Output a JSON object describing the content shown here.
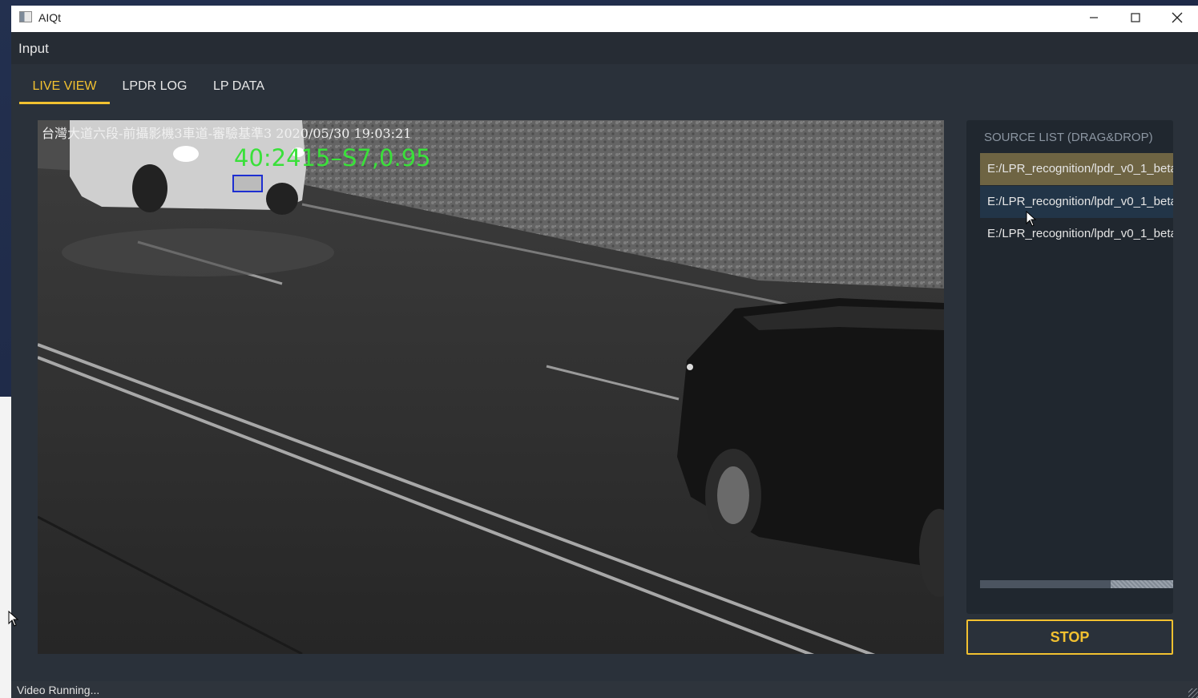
{
  "window": {
    "title": "AIQt",
    "minimize_icon": "minimize-icon",
    "maximize_icon": "maximize-icon",
    "close_icon": "close-icon"
  },
  "menu": {
    "items": [
      {
        "label": "Input"
      }
    ]
  },
  "tabs": [
    {
      "label": "LIVE VIEW",
      "active": true
    },
    {
      "label": "LPDR LOG",
      "active": false
    },
    {
      "label": "LP DATA",
      "active": false
    }
  ],
  "video": {
    "osd_caption": "台灣大道六段-前攝影機3車道-審驗基準3 2020/05/30 19:03:21",
    "detection_label": "40:2415–S7,0.95",
    "plate_box_color": "#1e2fd1",
    "detection_color": "#3ae03a"
  },
  "source_list": {
    "title": "SOURCE LIST (DRAG&DROP)",
    "items": [
      {
        "label": "E:/LPR_recognition/lpdr_v0_1_beta",
        "state": "selected"
      },
      {
        "label": "E:/LPR_recognition/lpdr_v0_1_beta",
        "state": "hover"
      },
      {
        "label": "E:/LPR_recognition/lpdr_v0_1_beta",
        "state": "normal"
      }
    ]
  },
  "stop_button": {
    "label": "STOP"
  },
  "status": {
    "text": "Video Running..."
  },
  "colors": {
    "accent": "#f2c130",
    "window_bg": "#2a313a",
    "panel_bg": "#20272f",
    "selected_item": "#6e6443",
    "hover_item": "#223548"
  }
}
